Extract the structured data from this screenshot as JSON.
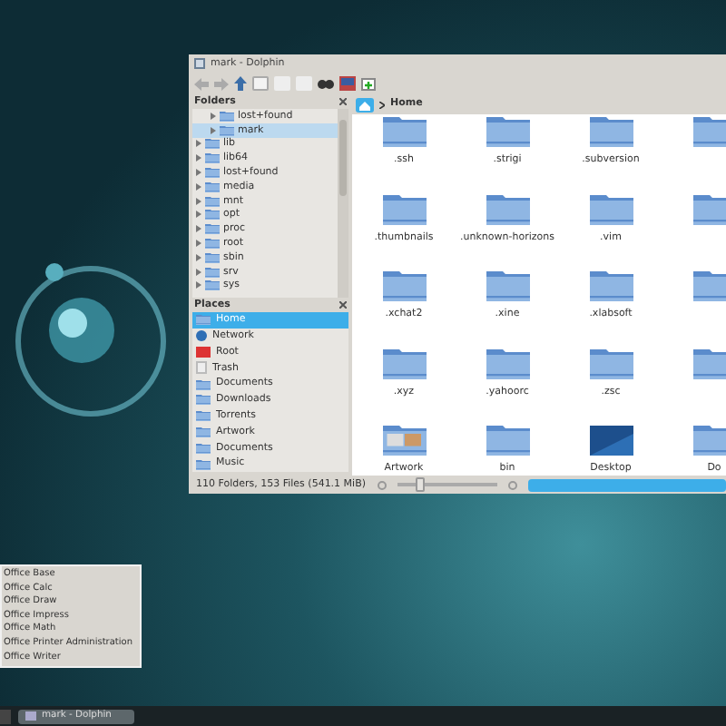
{
  "window": {
    "title": "mark - Dolphin"
  },
  "folders_panel": {
    "title": "Folders",
    "tree": [
      {
        "children": [
          {
            "label": "lost+found",
            "selected": false
          },
          {
            "label": "mark",
            "selected": true
          }
        ]
      },
      {
        "label": "lib",
        "selected": false
      },
      {
        "label": "lib64",
        "selected": false
      },
      {
        "label": "lost+found",
        "selected": false
      },
      {
        "label": "media",
        "selected": false
      },
      {
        "label": "mnt",
        "selected": false
      },
      {
        "label": "opt",
        "selected": false
      },
      {
        "label": "proc",
        "selected": false
      },
      {
        "label": "root",
        "selected": false
      },
      {
        "label": "sbin",
        "selected": false
      },
      {
        "label": "srv",
        "selected": false
      },
      {
        "label": "sys",
        "selected": false
      }
    ]
  },
  "places_panel": {
    "title": "Places",
    "items": [
      {
        "label": "Home",
        "kind": "home",
        "selected": true
      },
      {
        "label": "Network",
        "kind": "network",
        "selected": false
      },
      {
        "label": "Root",
        "kind": "root",
        "selected": false
      },
      {
        "label": "Trash",
        "kind": "trash",
        "selected": false
      },
      {
        "label": "Documents",
        "kind": "folder",
        "selected": false
      },
      {
        "label": "Downloads",
        "kind": "folder",
        "selected": false
      },
      {
        "label": "Torrents",
        "kind": "folder",
        "selected": false
      },
      {
        "label": "Artwork",
        "kind": "folder",
        "selected": false
      },
      {
        "label": "Documents",
        "kind": "folder",
        "selected": false
      },
      {
        "label": "Music",
        "kind": "folder",
        "selected": false
      }
    ]
  },
  "breadcrumb": {
    "current": "Home"
  },
  "files": [
    {
      "label": ".ssh",
      "kind": "folder"
    },
    {
      "label": ".strigi",
      "kind": "folder"
    },
    {
      "label": ".subversion",
      "kind": "folder"
    },
    {
      "kind": "folder"
    },
    {
      "label": ".thumbnails",
      "kind": "folder"
    },
    {
      "label": ".unknown-horizons",
      "kind": "folder"
    },
    {
      "label": ".vim",
      "kind": "folder"
    },
    {
      "kind": "folder"
    },
    {
      "label": ".xchat2",
      "kind": "folder"
    },
    {
      "label": ".xine",
      "kind": "folder"
    },
    {
      "label": ".xlabsoft",
      "kind": "folder"
    },
    {
      "kind": "folder"
    },
    {
      "label": ".xyz",
      "kind": "folder"
    },
    {
      "label": ".yahoorc",
      "kind": "folder"
    },
    {
      "label": ".zsc",
      "kind": "folder"
    },
    {
      "kind": "folder"
    },
    {
      "label": "Artwork",
      "kind": "pictures"
    },
    {
      "label": "bin",
      "kind": "folder"
    },
    {
      "label": "Desktop",
      "kind": "desktop"
    },
    {
      "label": "Do",
      "kind": "folder"
    }
  ],
  "status_bar": {
    "text": "110 Folders, 153 Files (541.1 MiB)",
    "zoom": {
      "level": 0.2
    },
    "capacity": {
      "level": 1
    }
  },
  "menu": {
    "items": [
      "Office Base",
      "Office Calc",
      "Office Draw",
      "Office Impress",
      "Office Math",
      "Office Printer Administration",
      "Office Writer"
    ]
  },
  "taskbar": {
    "tasks": [
      {
        "label": "mark - Dolphin"
      }
    ]
  }
}
